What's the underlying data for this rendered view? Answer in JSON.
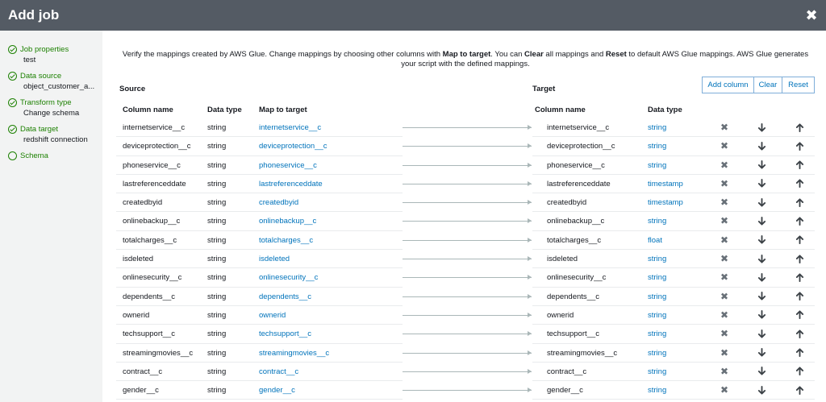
{
  "header": {
    "title": "Add job",
    "close_glyph": "✖"
  },
  "sidebar": {
    "steps": [
      {
        "label": "Job properties",
        "sub": "test",
        "done": true
      },
      {
        "label": "Data source",
        "sub": "object_customer_a...",
        "done": true
      },
      {
        "label": "Transform type",
        "sub": "Change schema",
        "done": true
      },
      {
        "label": "Data target",
        "sub": "redshift connection",
        "done": true
      },
      {
        "label": "Schema",
        "sub": "",
        "done": false
      }
    ]
  },
  "main": {
    "desc_1": "Verify the mappings created by AWS Glue. Change mappings by choosing other columns with ",
    "desc_b1": "Map to target",
    "desc_2": ". You can ",
    "desc_b2": "Clear",
    "desc_3": " all mappings and ",
    "desc_b3": "Reset",
    "desc_4": " to default AWS Glue mappings. AWS Glue generates your script with the defined mappings.",
    "source_title": "Source",
    "target_title": "Target",
    "buttons": {
      "add_column": "Add column",
      "clear": "Clear",
      "reset": "Reset"
    },
    "source_headers": {
      "column_name": "Column name",
      "data_type": "Data type",
      "map_to_target": "Map to target"
    },
    "target_headers": {
      "column_name": "Column name",
      "data_type": "Data type"
    },
    "rows": [
      {
        "src": "internetservice__c",
        "src_type": "string",
        "map": "internetservice__c",
        "tgt": "internetservice__c",
        "tgt_type": "string"
      },
      {
        "src": "deviceprotection__c",
        "src_type": "string",
        "map": "deviceprotection__c",
        "tgt": "deviceprotection__c",
        "tgt_type": "string"
      },
      {
        "src": "phoneservice__c",
        "src_type": "string",
        "map": "phoneservice__c",
        "tgt": "phoneservice__c",
        "tgt_type": "string"
      },
      {
        "src": "lastreferenceddate",
        "src_type": "string",
        "map": "lastreferenceddate",
        "tgt": "lastreferenceddate",
        "tgt_type": "timestamp"
      },
      {
        "src": "createdbyid",
        "src_type": "string",
        "map": "createdbyid",
        "tgt": "createdbyid",
        "tgt_type": "timestamp"
      },
      {
        "src": "onlinebackup__c",
        "src_type": "string",
        "map": "onlinebackup__c",
        "tgt": "onlinebackup__c",
        "tgt_type": "string"
      },
      {
        "src": "totalcharges__c",
        "src_type": "string",
        "map": "totalcharges__c",
        "tgt": "totalcharges__c",
        "tgt_type": "float"
      },
      {
        "src": "isdeleted",
        "src_type": "string",
        "map": "isdeleted",
        "tgt": "isdeleted",
        "tgt_type": "string"
      },
      {
        "src": "onlinesecurity__c",
        "src_type": "string",
        "map": "onlinesecurity__c",
        "tgt": "onlinesecurity__c",
        "tgt_type": "string"
      },
      {
        "src": "dependents__c",
        "src_type": "string",
        "map": "dependents__c",
        "tgt": "dependents__c",
        "tgt_type": "string"
      },
      {
        "src": "ownerid",
        "src_type": "string",
        "map": "ownerid",
        "tgt": "ownerid",
        "tgt_type": "string"
      },
      {
        "src": "techsupport__c",
        "src_type": "string",
        "map": "techsupport__c",
        "tgt": "techsupport__c",
        "tgt_type": "string"
      },
      {
        "src": "streamingmovies__c",
        "src_type": "string",
        "map": "streamingmovies__c",
        "tgt": "streamingmovies__c",
        "tgt_type": "string"
      },
      {
        "src": "contract__c",
        "src_type": "string",
        "map": "contract__c",
        "tgt": "contract__c",
        "tgt_type": "string"
      },
      {
        "src": "gender__c",
        "src_type": "string",
        "map": "gender__c",
        "tgt": "gender__c",
        "tgt_type": "string"
      }
    ]
  },
  "colors": {
    "header_bg": "#545b64",
    "link": "#0073bb",
    "step_green": "#1d8102",
    "sidebar_bg": "#f2f3f3"
  },
  "icons": {
    "remove": "close-icon",
    "move_down": "arrow-down-icon",
    "move_up": "arrow-up-icon",
    "step_done": "check-circle-icon",
    "step_pending": "empty-circle-icon"
  }
}
